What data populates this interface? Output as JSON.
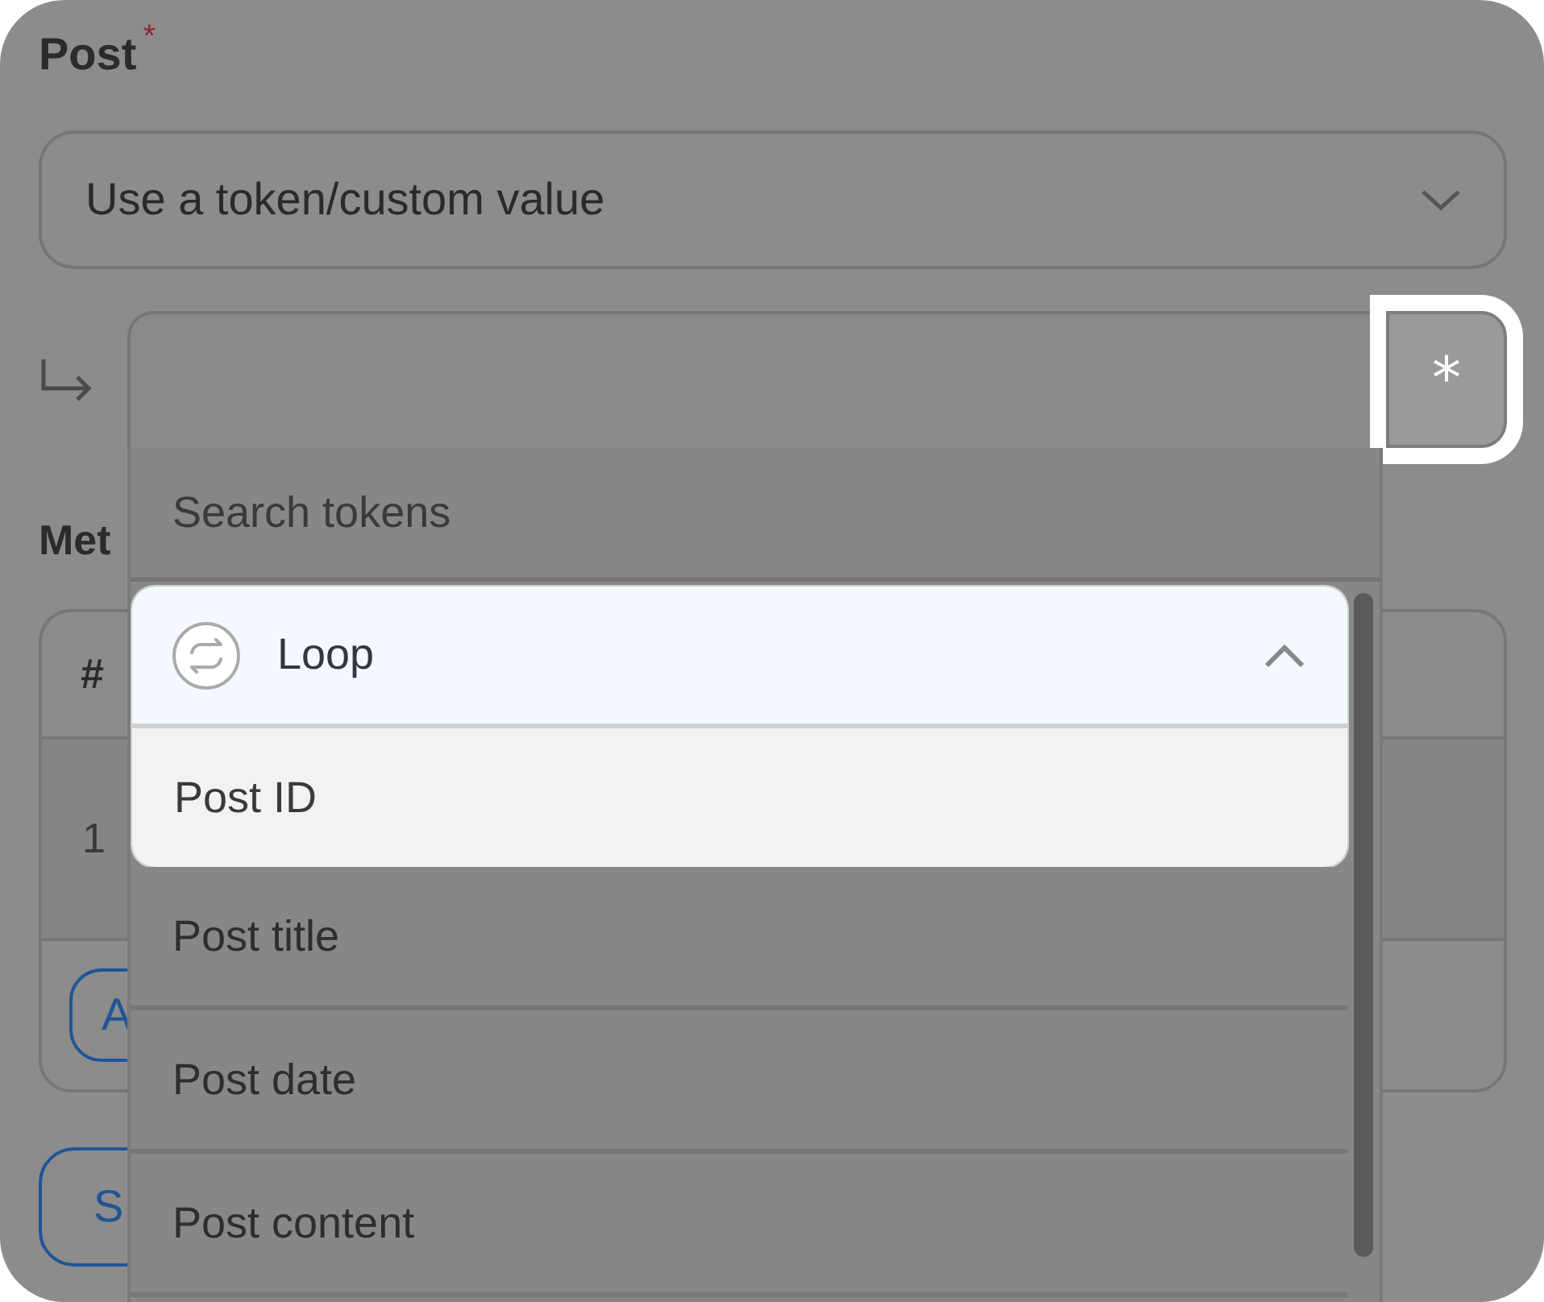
{
  "post_field": {
    "label": "Post",
    "required": true,
    "select": {
      "value": "Use a token/custom value",
      "expanded": false
    },
    "token_button": {
      "label": "*",
      "highlighted": true
    }
  },
  "meta_section": {
    "label": "Met",
    "table": {
      "columns": [
        "#"
      ],
      "rows": [
        [
          "1"
        ]
      ]
    },
    "add_button": "A"
  },
  "save_button": "S",
  "token_dropdown": {
    "search": {
      "placeholder": "Search tokens"
    },
    "groups": [
      {
        "label": "Loop",
        "expanded": true,
        "highlighted": true,
        "items": [
          {
            "label": "Post ID",
            "highlighted": true
          },
          {
            "label": "Post title",
            "highlighted": false
          },
          {
            "label": "Post date",
            "highlighted": false
          },
          {
            "label": "Post content",
            "highlighted": false
          }
        ]
      }
    ]
  }
}
